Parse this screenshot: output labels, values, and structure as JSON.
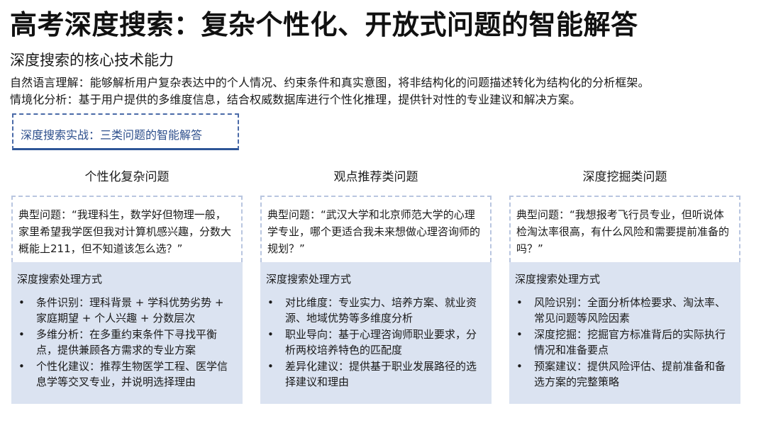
{
  "header": {
    "title": "高考深度搜索：复杂个性化、开放式问题的智能解答",
    "subtitle": "深度搜索的核心技术能力",
    "desc1": "自然语言理解：能够解析用户复杂表达中的个人情况、约束条件和真实意图，将非结构化的问题描述转化为结构化的分析框架。",
    "desc2": "情境化分析：基于用户提供的多维度信息，结合权威数据库进行个性化推理，提供针对性的专业建议和解决方案。"
  },
  "section": {
    "label": "深度搜索实战：三类问题的智能解答"
  },
  "columns": [
    {
      "title": "个性化复杂问题",
      "question": "典型问题：“我理科生，数学好但物理一般，家里希望我学医但我对计算机感兴趣，分数大概能上211，但不知道该怎么选？”",
      "process_title": "深度搜索处理方式",
      "items": [
        "条件识别：理科背景 + 学科优势劣势 + 家庭期望 + 个人兴趣 + 分数层次",
        "多维分析：在多重约束条件下寻找平衡点，提供兼顾各方需求的专业方案",
        "个性化建议：推荐生物医学工程、医学信息学等交叉专业，并说明选择理由"
      ]
    },
    {
      "title": "观点推荐类问题",
      "question": "典型问题：“武汉大学和北京师范大学的心理学专业，哪个更适合我未来想做心理咨询师的规划？”",
      "process_title": "深度搜索处理方式",
      "items": [
        "对比维度：专业实力、培养方案、就业资源、地域优势等多维度分析",
        "职业导向：基于心理咨询师职业要求，分析两校培养特色的匹配度",
        "差异化建议：提供基于职业发展路径的选择建议和理由"
      ]
    },
    {
      "title": "深度挖掘类问题",
      "question": "典型问题：“我想报考飞行员专业，但听说体检淘汰率很高，有什么风险和需要提前准备的吗？”",
      "process_title": "深度搜索处理方式",
      "items": [
        "风险识别：全面分析体检要求、淘汰率、常见问题等风险因素",
        "深度挖掘：挖掘官方标准背后的实际执行情况和准备要点",
        "预案建议：提供风险评估、提前准备和备选方案的完整策略"
      ]
    }
  ],
  "bullet_char": "•",
  "colors": {
    "accent": "#2d5597",
    "panel_bg": "#dbe3f1",
    "dashed_border": "#b9c6e0"
  }
}
